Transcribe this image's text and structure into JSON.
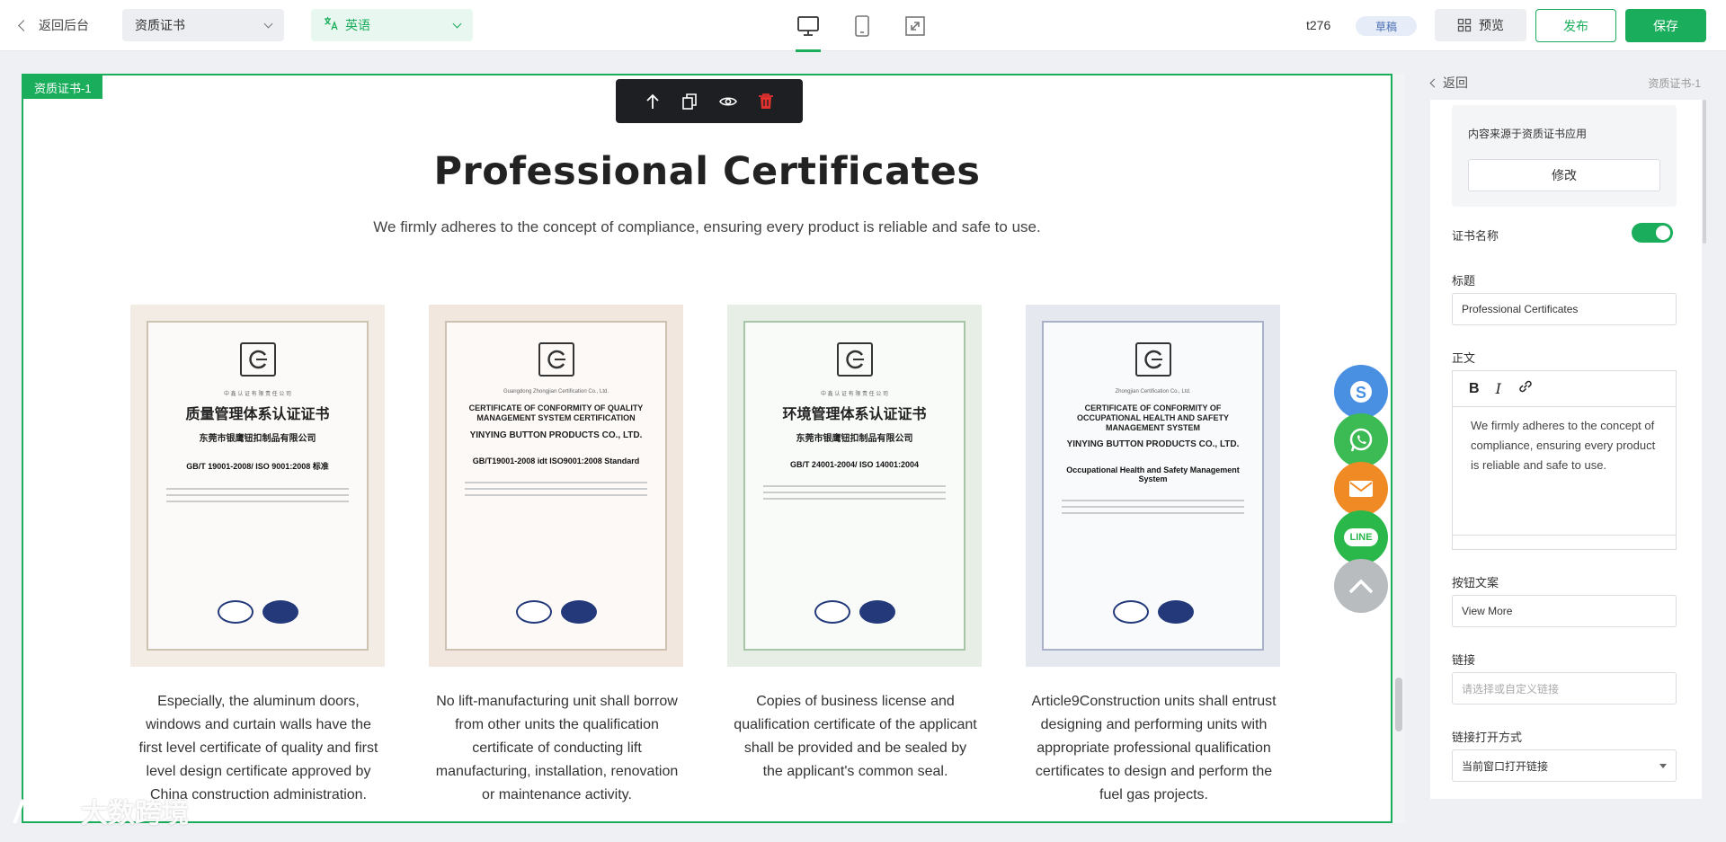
{
  "topbar": {
    "back_label": "返回后台",
    "page_select": "资质证书",
    "lang_select": "英语",
    "site_name": "t276",
    "status_badge": "草稿",
    "preview_label": "预览",
    "publish_label": "发布",
    "save_label": "保存",
    "devices": [
      "desktop-icon",
      "mobile-icon",
      "fullscreen-icon"
    ],
    "active_device": "desktop"
  },
  "canvas": {
    "section_tag": "资质证书-1",
    "toolbar_icons": [
      "arrow-up-icon",
      "copy-icon",
      "eye-icon",
      "trash-icon"
    ],
    "title": "Professional Certificates",
    "subtitle": "We firmly adheres to the concept of compliance, ensuring every product is reliable and safe to use.",
    "certificates": [
      {
        "caption": "Especially, the aluminum doors, windows and curtain walls have the first level certificate of quality and first level design certificate approved by China construction administration.",
        "heading": "质量管理体系认证证书",
        "company": "东莞市银鹰钮扣制品有限公司",
        "standard": "GB/T 19001-2008/ ISO 9001:2008 标准",
        "org": "中 鑫 认 证 有 限 责 任 公 司",
        "tint": "#f3ece4"
      },
      {
        "caption": "No lift-manufacturing unit shall borrow from other units the qualification certificate of conducting lift manufacturing, installation, renovation or maintenance activity.",
        "heading": "CERTIFICATE OF CONFORMITY OF QUALITY MANAGEMENT SYSTEM CERTIFICATION",
        "company": "YINYING BUTTON PRODUCTS CO., LTD.",
        "standard": "GB/T19001-2008 idt ISO9001:2008 Standard",
        "org": "Guangdong Zhongjian Certification Co., Ltd.",
        "tint": "#f1e7de"
      },
      {
        "caption": "Copies of business license and qualification certificate of the applicant shall be provided and be sealed by the applicant's common seal.",
        "heading": "环境管理体系认证证书",
        "company": "东莞市银鹰钮扣制品有限公司",
        "standard": "GB/T 24001-2004/ ISO 14001:2004",
        "org": "中 鑫 认 证 有 限 责 任 公 司",
        "tint": "#e6eee6"
      },
      {
        "caption": "Article9Construction units shall entrust designing and performing units with appropriate professional qualification certificates to design and perform the fuel gas projects.",
        "heading": "CERTIFICATE OF CONFORMITY OF OCCUPATIONAL HEALTH AND SAFETY MANAGEMENT SYSTEM",
        "company": "YINYING BUTTON PRODUCTS CO., LTD.",
        "standard": "Occupational Health and Safety Management System",
        "org": "Zhongjian Certification Co., Ltd.",
        "tint": "#e5e9ef"
      }
    ],
    "contact_buttons": [
      {
        "name": "skype",
        "color": "#4a90e2"
      },
      {
        "name": "whatsapp",
        "color": "#3cba54"
      },
      {
        "name": "email",
        "color": "#f08a24"
      },
      {
        "name": "line",
        "color": "#2bb84a",
        "label": "LINE"
      },
      {
        "name": "back-to-top",
        "color": "#b9bcbf"
      }
    ]
  },
  "panel": {
    "back_label": "返回",
    "crumb": "资质证书-1",
    "source_text": "内容来源于资质证书应用",
    "modify_label": "修改",
    "cert_name_label": "证书名称",
    "cert_name_enabled": true,
    "title_label": "标题",
    "title_value": "Professional Certificates",
    "body_label": "正文",
    "body_value": "We firmly adheres to the concept of compliance, ensuring every product is reliable and safe to use.",
    "button_text_label": "按钮文案",
    "button_text_value": "View More",
    "link_label": "链接",
    "link_placeholder": "请选择或自定义链接",
    "open_mode_label": "链接打开方式",
    "open_mode_value": "当前窗口打开链接"
  },
  "watermark": "大数跨境"
}
